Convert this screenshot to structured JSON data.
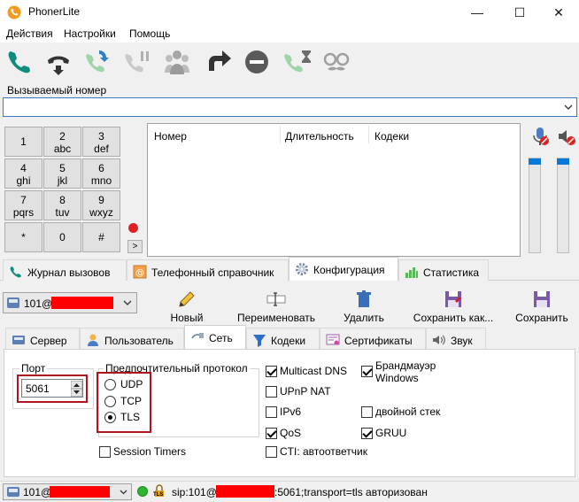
{
  "window": {
    "title": "PhonerLite",
    "minimize": "—",
    "maximize": "☐",
    "close": "✕"
  },
  "menu": [
    "Действия",
    "Настройки",
    "Помощь"
  ],
  "toolbar_icons": [
    "call-icon",
    "hang-up-icon",
    "redial-icon",
    "hold-icon",
    "conference-icon",
    "transfer-icon",
    "do-not-disturb-icon",
    "call-wait-icon",
    "anonymous-icon"
  ],
  "called_number": {
    "label": "Вызываемый номер",
    "value": ""
  },
  "keypad": [
    {
      "d": "1",
      "l": ""
    },
    {
      "d": "2",
      "l": "abc"
    },
    {
      "d": "3",
      "l": "def"
    },
    {
      "d": "4",
      "l": "ghi"
    },
    {
      "d": "5",
      "l": "jkl"
    },
    {
      "d": "6",
      "l": "mno"
    },
    {
      "d": "7",
      "l": "pqrs"
    },
    {
      "d": "8",
      "l": "tuv"
    },
    {
      "d": "9",
      "l": "wxyz"
    },
    {
      "d": "*",
      "l": ""
    },
    {
      "d": "0",
      "l": ""
    },
    {
      "d": "#",
      "l": ""
    }
  ],
  "keypad_more": ">",
  "call_list": {
    "columns": [
      "Номер",
      "Длительность",
      "Кодеки"
    ]
  },
  "main_tabs": [
    "Журнал вызовов",
    "Телефонный справочник",
    "Конфигурация",
    "Статистика"
  ],
  "active_main_tab": "Конфигурация",
  "account": {
    "prefix": "101@"
  },
  "actions": [
    "Новый",
    "Переименовать",
    "Удалить",
    "Сохранить как...",
    "Сохранить"
  ],
  "sub_tabs": [
    "Сервер",
    "Пользователь",
    "Сеть",
    "Кодеки",
    "Сертификаты",
    "Звук"
  ],
  "active_sub_tab": "Сеть",
  "network": {
    "port_label": "Порт",
    "port_value": "5061",
    "protocol_label": "Предпочтительный протокол",
    "protocols": [
      {
        "label": "UDP",
        "checked": false
      },
      {
        "label": "TCP",
        "checked": false
      },
      {
        "label": "TLS",
        "checked": true
      }
    ],
    "session_timers": {
      "label": "Session Timers",
      "checked": false
    },
    "options_left": [
      {
        "label": "Multicast DNS",
        "checked": true
      },
      {
        "label": "UPnP NAT",
        "checked": false
      },
      {
        "label": "IPv6",
        "checked": false
      },
      {
        "label": "QoS",
        "checked": true
      },
      {
        "label": "CTI: автоответчик",
        "checked": false
      }
    ],
    "options_right": [
      {
        "label": "Брандмауэр\nWindows",
        "checked": true
      },
      {
        "label": "двойной стек",
        "checked": false
      },
      {
        "label": "GRUU",
        "checked": true
      }
    ]
  },
  "status": {
    "account_prefix": "101@",
    "tls_badge": "TLS",
    "sip_prefix": "sip:101@",
    "sip_suffix": ":5061;transport=tls авторизован",
    "online_color": "#2db52d"
  }
}
